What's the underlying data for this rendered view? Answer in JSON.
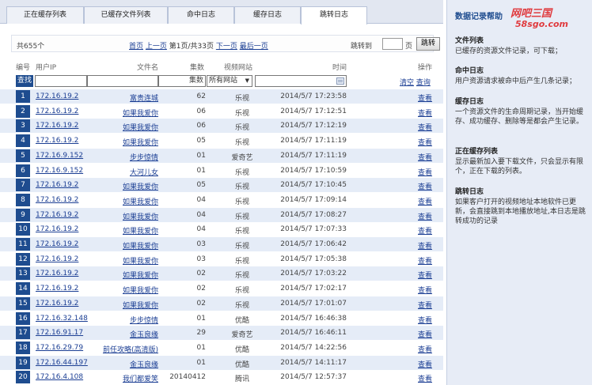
{
  "tabs": [
    {
      "label": "正在缓存列表"
    },
    {
      "label": "已缓存文件列表"
    },
    {
      "label": "命中日志"
    },
    {
      "label": "缓存日志"
    },
    {
      "label": "跳转日志"
    }
  ],
  "toolbar": {
    "count": "共655个",
    "first": "首页",
    "prev": "上一页",
    "page_info": "第1页/共33页",
    "next": "下一页",
    "last": "最后一页",
    "jump_label": "跳转到",
    "page_suffix": "页",
    "jump_button": "跳转"
  },
  "columns": {
    "num": "编号",
    "ip": "用户IP",
    "name": "文件名",
    "eps": "集数",
    "site": "视频网站",
    "time": "时间",
    "op": "操作"
  },
  "filter": {
    "search_button": "查找",
    "eps_placeholder": "集数",
    "site_selected": "所有网站",
    "clear": "清空",
    "query": "查询"
  },
  "rows": [
    {
      "num": "1",
      "ip": "172.16.19.2",
      "name": "富贵连城",
      "eps": "62",
      "site": "乐视",
      "time": "2014/5/7 17:23:58",
      "op": "查看"
    },
    {
      "num": "2",
      "ip": "172.16.19.2",
      "name": "如果我爱你",
      "eps": "06",
      "site": "乐视",
      "time": "2014/5/7 17:12:51",
      "op": "查看"
    },
    {
      "num": "3",
      "ip": "172.16.19.2",
      "name": "如果我爱你",
      "eps": "06",
      "site": "乐视",
      "time": "2014/5/7 17:12:19",
      "op": "查看"
    },
    {
      "num": "4",
      "ip": "172.16.19.2",
      "name": "如果我爱你",
      "eps": "05",
      "site": "乐视",
      "time": "2014/5/7 17:11:19",
      "op": "查看"
    },
    {
      "num": "5",
      "ip": "172.16.9.152",
      "name": "步步惊情",
      "eps": "01",
      "site": "爱奇艺",
      "time": "2014/5/7 17:11:19",
      "op": "查看"
    },
    {
      "num": "6",
      "ip": "172.16.9.152",
      "name": "大河儿女",
      "eps": "01",
      "site": "乐视",
      "time": "2014/5/7 17:10:59",
      "op": "查看"
    },
    {
      "num": "7",
      "ip": "172.16.19.2",
      "name": "如果我爱你",
      "eps": "05",
      "site": "乐视",
      "time": "2014/5/7 17:10:45",
      "op": "查看"
    },
    {
      "num": "8",
      "ip": "172.16.19.2",
      "name": "如果我爱你",
      "eps": "04",
      "site": "乐视",
      "time": "2014/5/7 17:09:14",
      "op": "查看"
    },
    {
      "num": "9",
      "ip": "172.16.19.2",
      "name": "如果我爱你",
      "eps": "04",
      "site": "乐视",
      "time": "2014/5/7 17:08:27",
      "op": "查看"
    },
    {
      "num": "10",
      "ip": "172.16.19.2",
      "name": "如果我爱你",
      "eps": "04",
      "site": "乐视",
      "time": "2014/5/7 17:07:33",
      "op": "查看"
    },
    {
      "num": "11",
      "ip": "172.16.19.2",
      "name": "如果我爱你",
      "eps": "03",
      "site": "乐视",
      "time": "2014/5/7 17:06:42",
      "op": "查看"
    },
    {
      "num": "12",
      "ip": "172.16.19.2",
      "name": "如果我爱你",
      "eps": "03",
      "site": "乐视",
      "time": "2014/5/7 17:05:38",
      "op": "查看"
    },
    {
      "num": "13",
      "ip": "172.16.19.2",
      "name": "如果我爱你",
      "eps": "02",
      "site": "乐视",
      "time": "2014/5/7 17:03:22",
      "op": "查看"
    },
    {
      "num": "14",
      "ip": "172.16.19.2",
      "name": "如果我爱你",
      "eps": "02",
      "site": "乐视",
      "time": "2014/5/7 17:02:17",
      "op": "查看"
    },
    {
      "num": "15",
      "ip": "172.16.19.2",
      "name": "如果我爱你",
      "eps": "02",
      "site": "乐视",
      "time": "2014/5/7 17:01:07",
      "op": "查看"
    },
    {
      "num": "16",
      "ip": "172.16.32.148",
      "name": "步步惊情",
      "eps": "01",
      "site": "优酷",
      "time": "2014/5/7 16:46:38",
      "op": "查看"
    },
    {
      "num": "17",
      "ip": "172.16.91.17",
      "name": "金玉良缘",
      "eps": "29",
      "site": "爱奇艺",
      "time": "2014/5/7 16:46:11",
      "op": "查看"
    },
    {
      "num": "18",
      "ip": "172.16.29.79",
      "name": "前任攻略(高清版)",
      "eps": "01",
      "site": "优酷",
      "time": "2014/5/7 14:22:56",
      "op": "查看"
    },
    {
      "num": "19",
      "ip": "172.16.44.197",
      "name": "金玉良缘",
      "eps": "01",
      "site": "优酷",
      "time": "2014/5/7 14:11:17",
      "op": "查看"
    },
    {
      "num": "20",
      "ip": "172.16.4.108",
      "name": "我们都爱笑",
      "eps": "20140412",
      "site": "腾讯",
      "time": "2014/5/7 12:57:37",
      "op": "查看"
    }
  ],
  "help": {
    "title": "数据记录帮助",
    "logo_line1": "网吧三国",
    "logo_line2": "58sgo.com",
    "sections": [
      {
        "heading": "文件列表",
        "text": "已缓存的资源文件记录，可下载；"
      },
      {
        "heading": "命中日志",
        "text": "用户资源请求被命中后产生几条记录；"
      },
      {
        "heading": "缓存日志",
        "text": "一个资源文件的生命周期记录，当开始缓存、成功缓存、删除等是都会产生记录。"
      },
      {
        "heading": "正在缓存列表",
        "text": "显示最新加入要下载文件，只会显示有限个，正在下载的列表。"
      },
      {
        "heading": "跳转日志",
        "text": "如果客户打开的视频地址本地软件已更新，会直接跳到本地播放地址,本日志是跳转成功的记录"
      }
    ]
  },
  "colors": {
    "accent": "#1e4c8f",
    "link": "#1c3f94",
    "row_alt": "#e5ecf7",
    "sidebar_bg": "#e7ecf6",
    "logo": "#e03a3e"
  }
}
